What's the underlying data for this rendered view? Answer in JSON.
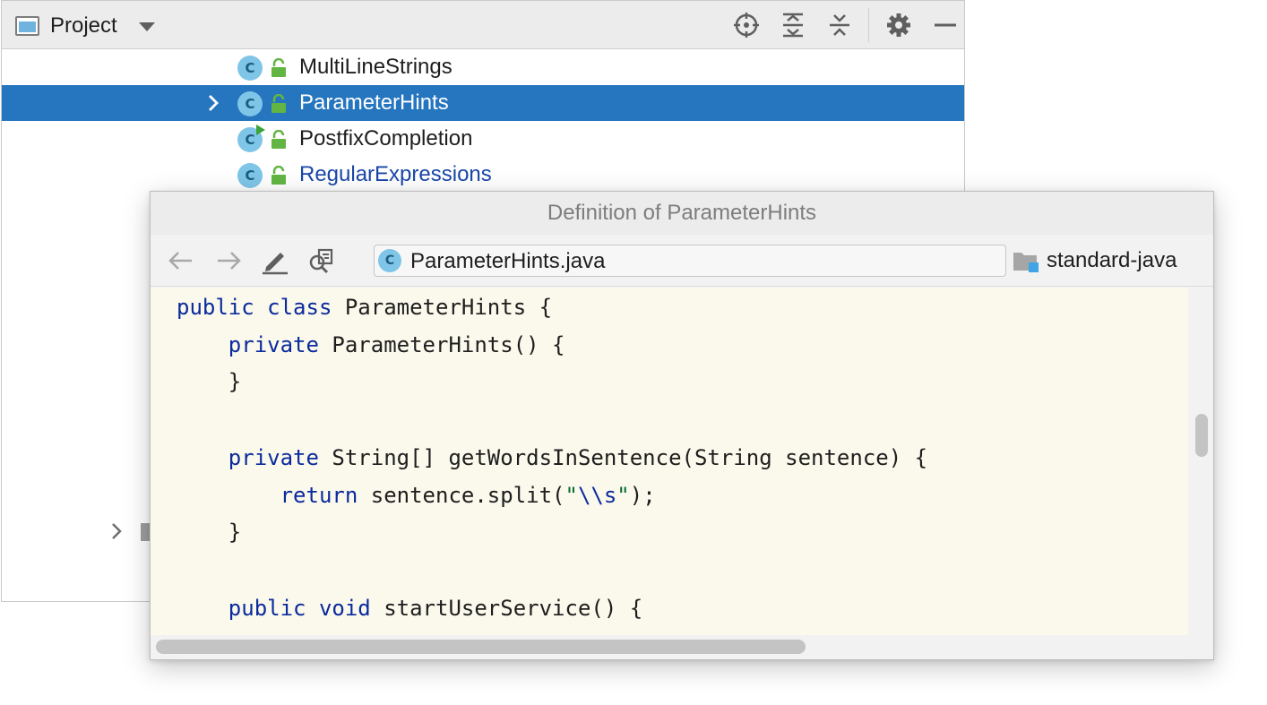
{
  "project_panel": {
    "title": "Project",
    "toolbar": {
      "locate_icon": "crosshair-icon",
      "expand_icon": "expand-all-icon",
      "collapse_icon": "collapse-all-icon",
      "settings_icon": "gear-icon",
      "hide_icon": "minimize-icon"
    },
    "tree": [
      {
        "label": "MultiLineStrings",
        "class_letter": "C",
        "selected": false,
        "expandable": false,
        "runnable": false,
        "style": "normal"
      },
      {
        "label": "ParameterHints",
        "class_letter": "C",
        "selected": true,
        "expandable": true,
        "runnable": false,
        "style": "normal"
      },
      {
        "label": "PostfixCompletion",
        "class_letter": "C",
        "selected": false,
        "expandable": false,
        "runnable": true,
        "style": "normal"
      },
      {
        "label": "RegularExpressions",
        "class_letter": "C",
        "selected": false,
        "expandable": false,
        "runnable": false,
        "style": "link"
      }
    ]
  },
  "popup": {
    "title": "Definition of ParameterHints",
    "toolbar": {
      "back_icon": "arrow-left-icon",
      "forward_icon": "arrow-right-icon",
      "edit_icon": "pencil-icon",
      "find_usages_icon": "find-usages-icon"
    },
    "file": {
      "class_letter": "C",
      "name": "ParameterHints.java"
    },
    "module": {
      "icon": "module-folder-icon",
      "name": "standard-java"
    },
    "code_lines": [
      "public class ParameterHints {",
      "    private ParameterHints() {",
      "    }",
      "",
      "    private String[] getWordsInSentence(String sentence) {",
      "        return sentence.split(\"\\\\s\");",
      "    }",
      "",
      "    public void startUserService() {"
    ]
  },
  "colors": {
    "selection": "#2675bf",
    "code_background": "#fbf9ec",
    "keyword": "#0b2b9c",
    "string": "#0a6b2f",
    "link": "#1a47a8",
    "class_icon": "#7fc5e8"
  }
}
